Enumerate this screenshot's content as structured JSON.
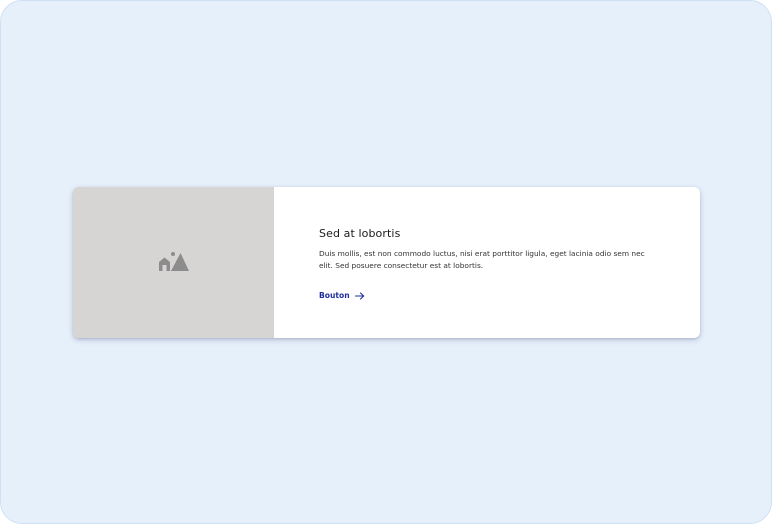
{
  "card": {
    "image_icon": "image-placeholder-icon",
    "title": "Sed at lobortis",
    "description": "Duis mollis, est non commodo luctus, nisi erat porttitor ligula, eget lacinia odio sem nec elit. Sed posuere consectetur est at lobortis.",
    "button_label": "Bouton",
    "button_icon": "arrow-right-icon"
  },
  "colors": {
    "page_background": "#e6f0fb",
    "card_background": "#ffffff",
    "media_placeholder": "#d6d5d3",
    "icon_gray": "#8c8c8c",
    "accent": "#1f2f9e"
  }
}
